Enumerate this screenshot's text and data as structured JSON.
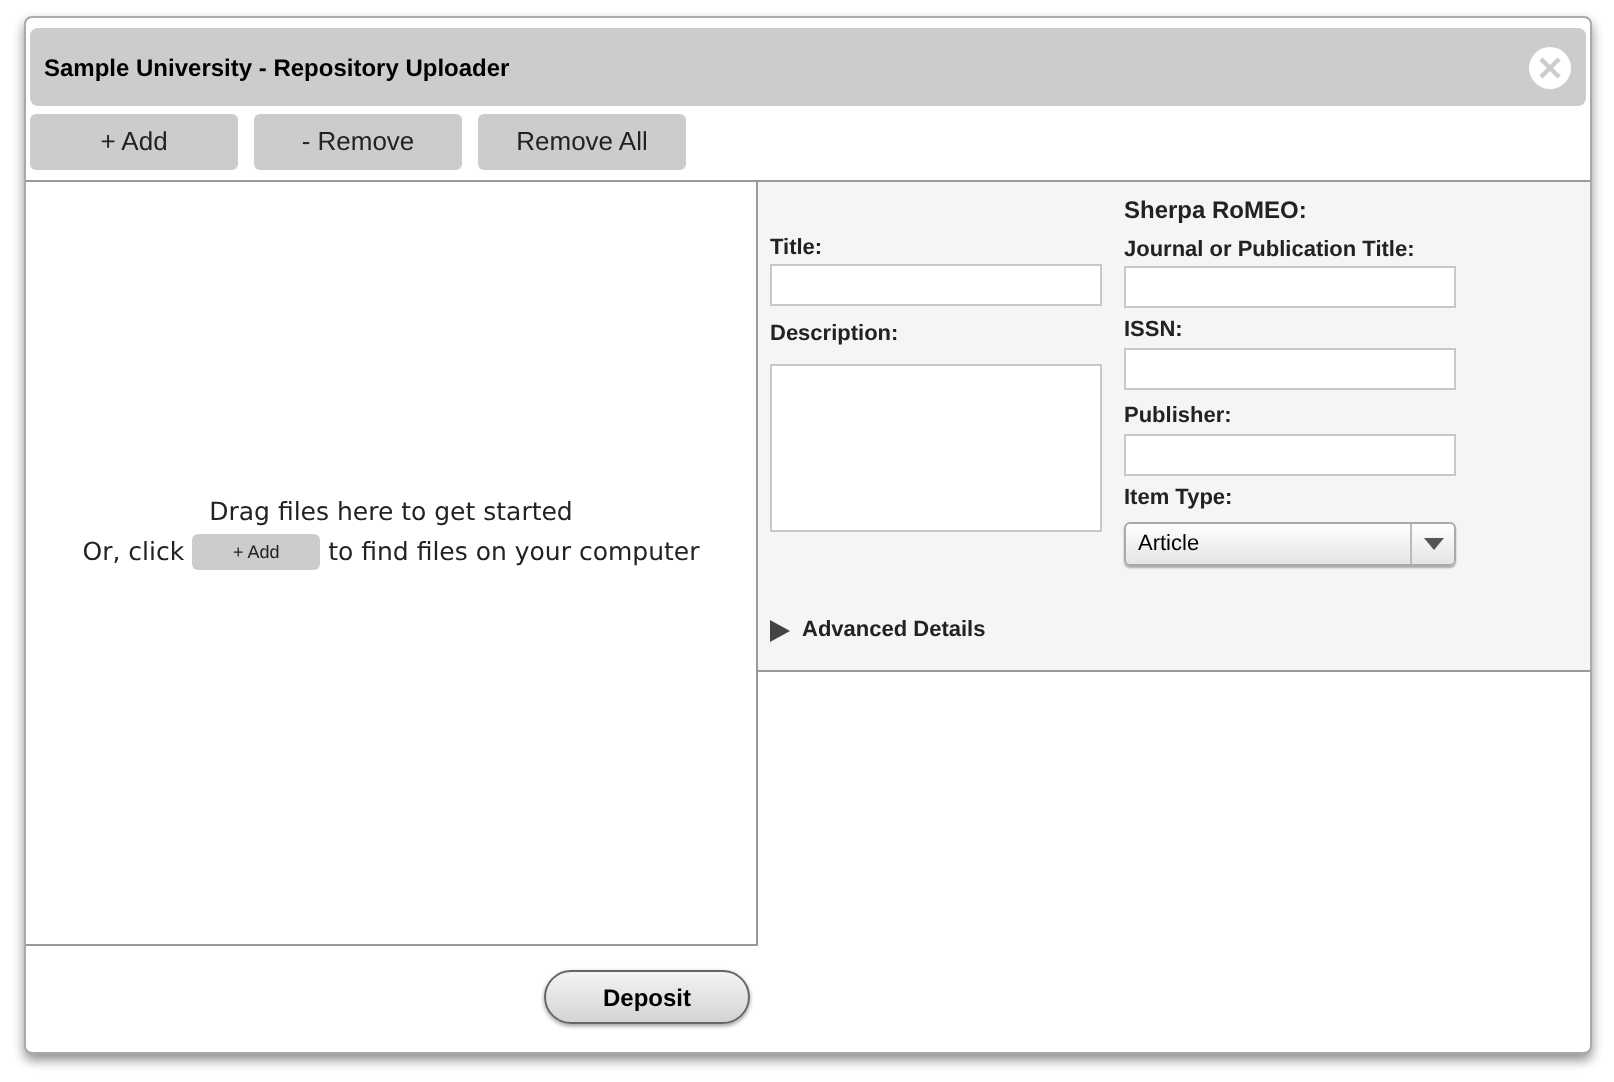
{
  "window": {
    "title": "Sample University - Repository Uploader"
  },
  "toolbar": [
    "+ Add",
    "- Remove",
    "Remove All"
  ],
  "dropzone": {
    "line_1": "Drag files here to get started",
    "line_2_before": "Or, click",
    "add_button": "+ Add",
    "line_2_after": "to find files on your computer"
  },
  "form": {
    "title_label": "Title:",
    "description_label": "Description:",
    "sherpa_heading": "Sherpa RoMEO:",
    "journal_label": "Journal or Publication Title:",
    "issn_label": "ISSN:",
    "publisher_label": "Publisher:",
    "item_type_label": "Item Type:",
    "item_type_value": "Article",
    "advanced": {
      "label": "Advanced Details",
      "expanded": false
    }
  },
  "deposit_button": "Deposit"
}
